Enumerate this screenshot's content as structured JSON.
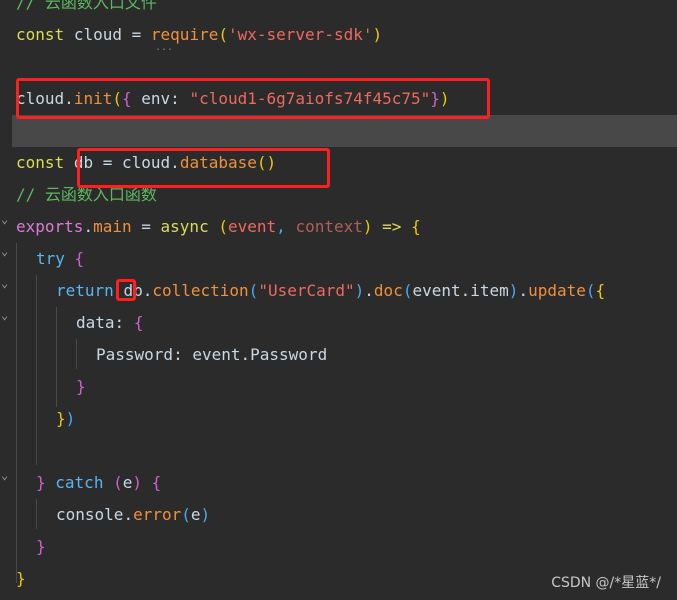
{
  "editor": {
    "theme_colors": {
      "background": "#2b2b2b",
      "current_line": "#484848",
      "annotation_box": "#ff1f1f"
    },
    "lines": {
      "l1_comment": "// 云函数入口文件",
      "l2": {
        "kw": "const",
        "var": "cloud",
        "op": "=",
        "fn": "require",
        "arg": "'wx-server-sdk'"
      },
      "l4": {
        "obj": "cloud",
        "fn": "init",
        "key": "env:",
        "value": "\"cloud1-6g7aiofs74f45c75\""
      },
      "l6": {
        "kw": "const",
        "var": "db",
        "op": "=",
        "obj": "cloud",
        "fn": "database"
      },
      "l7_comment": "// 云函数入口函数",
      "l8": {
        "obj": "exports",
        "prop": "main",
        "op": "=",
        "kw": "async",
        "p1": "event",
        "p2": "context",
        "arrow": "=>"
      },
      "l9": {
        "kw": "try"
      },
      "l10": {
        "kw": "return",
        "obj": "db",
        "fn1": "collection",
        "arg1": "\"UserCard\"",
        "fn2": "doc",
        "arg2": "event.item",
        "fn3": "update"
      },
      "l11": {
        "key": "data:"
      },
      "l12": {
        "key": "Password:",
        "value": "event.Password"
      },
      "l16": {
        "kw": "catch",
        "param": "e"
      },
      "l17": {
        "obj": "console",
        "fn": "error",
        "arg": "e"
      }
    },
    "collapsed_hint": "..."
  },
  "watermark": "CSDN @/*星蓝*/"
}
